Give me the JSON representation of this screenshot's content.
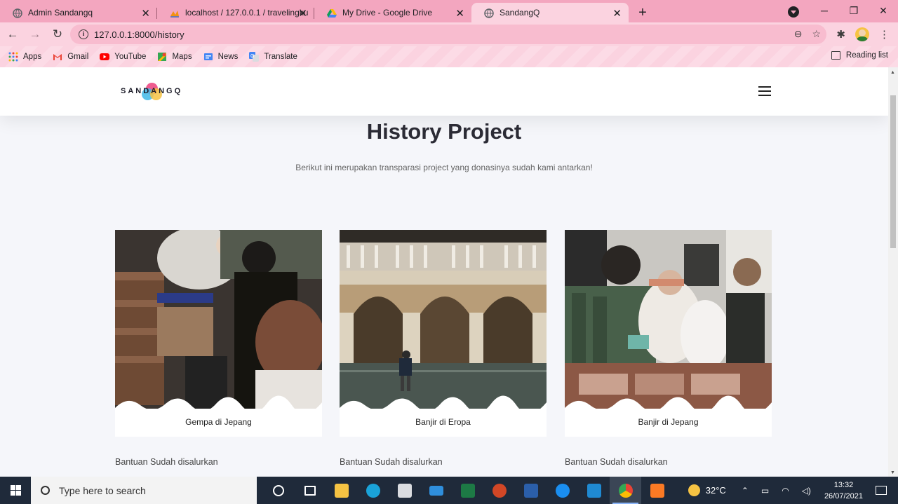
{
  "browser": {
    "tabs": [
      {
        "title": "Admin Sandangq",
        "active": false
      },
      {
        "title": "localhost / 127.0.0.1 / travelingku",
        "active": false
      },
      {
        "title": "My Drive - Google Drive",
        "active": false
      },
      {
        "title": "SandangQ",
        "active": true
      }
    ],
    "url": "127.0.0.1:8000/history",
    "bookmarks": [
      "Apps",
      "Gmail",
      "YouTube",
      "Maps",
      "News",
      "Translate"
    ],
    "reading_list": "Reading list",
    "colors": {
      "frame": "#f3a6bf",
      "toolbar": "#fbd3e0"
    }
  },
  "site": {
    "logo_text": "SANDANGQ",
    "title": "History Project",
    "subtitle": "Berikut ini merupakan transparasi project yang donasinya sudah kami antarkan!",
    "projects": [
      {
        "caption": "Gempa di Jepang",
        "status": "Bantuan Sudah disalurkan"
      },
      {
        "caption": "Banjir di Eropa",
        "status": "Bantuan Sudah disalurkan"
      },
      {
        "caption": "Banjir di Jepang",
        "status": "Bantuan Sudah disalurkan"
      }
    ]
  },
  "taskbar": {
    "search_placeholder": "Type here to search",
    "weather": "32°C",
    "time": "13:32",
    "date": "26/07/2021"
  }
}
